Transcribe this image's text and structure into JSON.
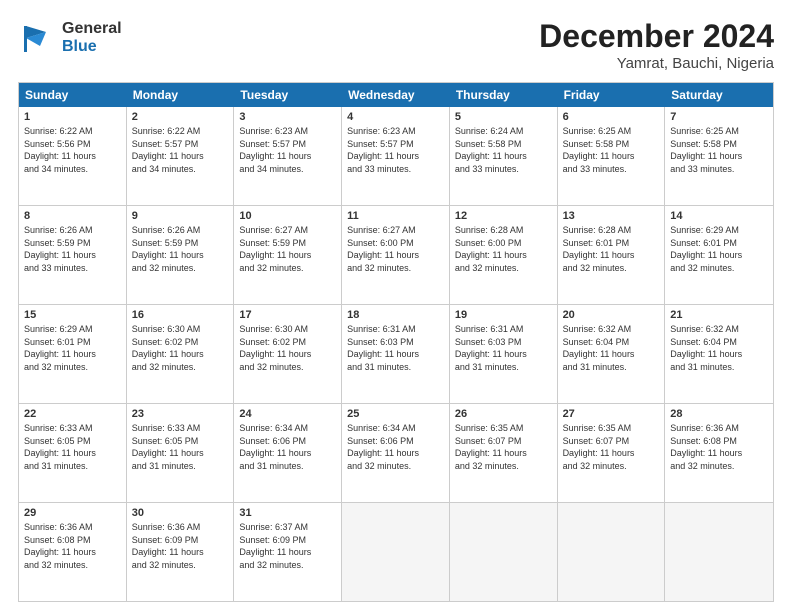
{
  "header": {
    "logo_general": "General",
    "logo_blue": "Blue",
    "title": "December 2024",
    "subtitle": "Yamrat, Bauchi, Nigeria"
  },
  "calendar": {
    "days": [
      "Sunday",
      "Monday",
      "Tuesday",
      "Wednesday",
      "Thursday",
      "Friday",
      "Saturday"
    ],
    "weeks": [
      [
        {
          "num": "",
          "empty": true,
          "lines": []
        },
        {
          "num": "",
          "empty": true,
          "lines": []
        },
        {
          "num": "",
          "empty": true,
          "lines": []
        },
        {
          "num": "",
          "empty": true,
          "lines": []
        },
        {
          "num": "",
          "empty": true,
          "lines": []
        },
        {
          "num": "",
          "empty": true,
          "lines": []
        },
        {
          "num": "",
          "empty": true,
          "lines": []
        }
      ],
      [
        {
          "num": "1",
          "empty": false,
          "lines": [
            "Sunrise: 6:22 AM",
            "Sunset: 5:56 PM",
            "Daylight: 11 hours",
            "and 34 minutes."
          ]
        },
        {
          "num": "2",
          "empty": false,
          "lines": [
            "Sunrise: 6:22 AM",
            "Sunset: 5:57 PM",
            "Daylight: 11 hours",
            "and 34 minutes."
          ]
        },
        {
          "num": "3",
          "empty": false,
          "lines": [
            "Sunrise: 6:23 AM",
            "Sunset: 5:57 PM",
            "Daylight: 11 hours",
            "and 34 minutes."
          ]
        },
        {
          "num": "4",
          "empty": false,
          "lines": [
            "Sunrise: 6:23 AM",
            "Sunset: 5:57 PM",
            "Daylight: 11 hours",
            "and 33 minutes."
          ]
        },
        {
          "num": "5",
          "empty": false,
          "lines": [
            "Sunrise: 6:24 AM",
            "Sunset: 5:58 PM",
            "Daylight: 11 hours",
            "and 33 minutes."
          ]
        },
        {
          "num": "6",
          "empty": false,
          "lines": [
            "Sunrise: 6:25 AM",
            "Sunset: 5:58 PM",
            "Daylight: 11 hours",
            "and 33 minutes."
          ]
        },
        {
          "num": "7",
          "empty": false,
          "lines": [
            "Sunrise: 6:25 AM",
            "Sunset: 5:58 PM",
            "Daylight: 11 hours",
            "and 33 minutes."
          ]
        }
      ],
      [
        {
          "num": "8",
          "empty": false,
          "lines": [
            "Sunrise: 6:26 AM",
            "Sunset: 5:59 PM",
            "Daylight: 11 hours",
            "and 33 minutes."
          ]
        },
        {
          "num": "9",
          "empty": false,
          "lines": [
            "Sunrise: 6:26 AM",
            "Sunset: 5:59 PM",
            "Daylight: 11 hours",
            "and 32 minutes."
          ]
        },
        {
          "num": "10",
          "empty": false,
          "lines": [
            "Sunrise: 6:27 AM",
            "Sunset: 5:59 PM",
            "Daylight: 11 hours",
            "and 32 minutes."
          ]
        },
        {
          "num": "11",
          "empty": false,
          "lines": [
            "Sunrise: 6:27 AM",
            "Sunset: 6:00 PM",
            "Daylight: 11 hours",
            "and 32 minutes."
          ]
        },
        {
          "num": "12",
          "empty": false,
          "lines": [
            "Sunrise: 6:28 AM",
            "Sunset: 6:00 PM",
            "Daylight: 11 hours",
            "and 32 minutes."
          ]
        },
        {
          "num": "13",
          "empty": false,
          "lines": [
            "Sunrise: 6:28 AM",
            "Sunset: 6:01 PM",
            "Daylight: 11 hours",
            "and 32 minutes."
          ]
        },
        {
          "num": "14",
          "empty": false,
          "lines": [
            "Sunrise: 6:29 AM",
            "Sunset: 6:01 PM",
            "Daylight: 11 hours",
            "and 32 minutes."
          ]
        }
      ],
      [
        {
          "num": "15",
          "empty": false,
          "lines": [
            "Sunrise: 6:29 AM",
            "Sunset: 6:01 PM",
            "Daylight: 11 hours",
            "and 32 minutes."
          ]
        },
        {
          "num": "16",
          "empty": false,
          "lines": [
            "Sunrise: 6:30 AM",
            "Sunset: 6:02 PM",
            "Daylight: 11 hours",
            "and 32 minutes."
          ]
        },
        {
          "num": "17",
          "empty": false,
          "lines": [
            "Sunrise: 6:30 AM",
            "Sunset: 6:02 PM",
            "Daylight: 11 hours",
            "and 32 minutes."
          ]
        },
        {
          "num": "18",
          "empty": false,
          "lines": [
            "Sunrise: 6:31 AM",
            "Sunset: 6:03 PM",
            "Daylight: 11 hours",
            "and 31 minutes."
          ]
        },
        {
          "num": "19",
          "empty": false,
          "lines": [
            "Sunrise: 6:31 AM",
            "Sunset: 6:03 PM",
            "Daylight: 11 hours",
            "and 31 minutes."
          ]
        },
        {
          "num": "20",
          "empty": false,
          "lines": [
            "Sunrise: 6:32 AM",
            "Sunset: 6:04 PM",
            "Daylight: 11 hours",
            "and 31 minutes."
          ]
        },
        {
          "num": "21",
          "empty": false,
          "lines": [
            "Sunrise: 6:32 AM",
            "Sunset: 6:04 PM",
            "Daylight: 11 hours",
            "and 31 minutes."
          ]
        }
      ],
      [
        {
          "num": "22",
          "empty": false,
          "lines": [
            "Sunrise: 6:33 AM",
            "Sunset: 6:05 PM",
            "Daylight: 11 hours",
            "and 31 minutes."
          ]
        },
        {
          "num": "23",
          "empty": false,
          "lines": [
            "Sunrise: 6:33 AM",
            "Sunset: 6:05 PM",
            "Daylight: 11 hours",
            "and 31 minutes."
          ]
        },
        {
          "num": "24",
          "empty": false,
          "lines": [
            "Sunrise: 6:34 AM",
            "Sunset: 6:06 PM",
            "Daylight: 11 hours",
            "and 31 minutes."
          ]
        },
        {
          "num": "25",
          "empty": false,
          "lines": [
            "Sunrise: 6:34 AM",
            "Sunset: 6:06 PM",
            "Daylight: 11 hours",
            "and 32 minutes."
          ]
        },
        {
          "num": "26",
          "empty": false,
          "lines": [
            "Sunrise: 6:35 AM",
            "Sunset: 6:07 PM",
            "Daylight: 11 hours",
            "and 32 minutes."
          ]
        },
        {
          "num": "27",
          "empty": false,
          "lines": [
            "Sunrise: 6:35 AM",
            "Sunset: 6:07 PM",
            "Daylight: 11 hours",
            "and 32 minutes."
          ]
        },
        {
          "num": "28",
          "empty": false,
          "lines": [
            "Sunrise: 6:36 AM",
            "Sunset: 6:08 PM",
            "Daylight: 11 hours",
            "and 32 minutes."
          ]
        }
      ],
      [
        {
          "num": "29",
          "empty": false,
          "lines": [
            "Sunrise: 6:36 AM",
            "Sunset: 6:08 PM",
            "Daylight: 11 hours",
            "and 32 minutes."
          ]
        },
        {
          "num": "30",
          "empty": false,
          "lines": [
            "Sunrise: 6:36 AM",
            "Sunset: 6:09 PM",
            "Daylight: 11 hours",
            "and 32 minutes."
          ]
        },
        {
          "num": "31",
          "empty": false,
          "lines": [
            "Sunrise: 6:37 AM",
            "Sunset: 6:09 PM",
            "Daylight: 11 hours",
            "and 32 minutes."
          ]
        },
        {
          "num": "",
          "empty": true,
          "lines": []
        },
        {
          "num": "",
          "empty": true,
          "lines": []
        },
        {
          "num": "",
          "empty": true,
          "lines": []
        },
        {
          "num": "",
          "empty": true,
          "lines": []
        }
      ]
    ]
  }
}
